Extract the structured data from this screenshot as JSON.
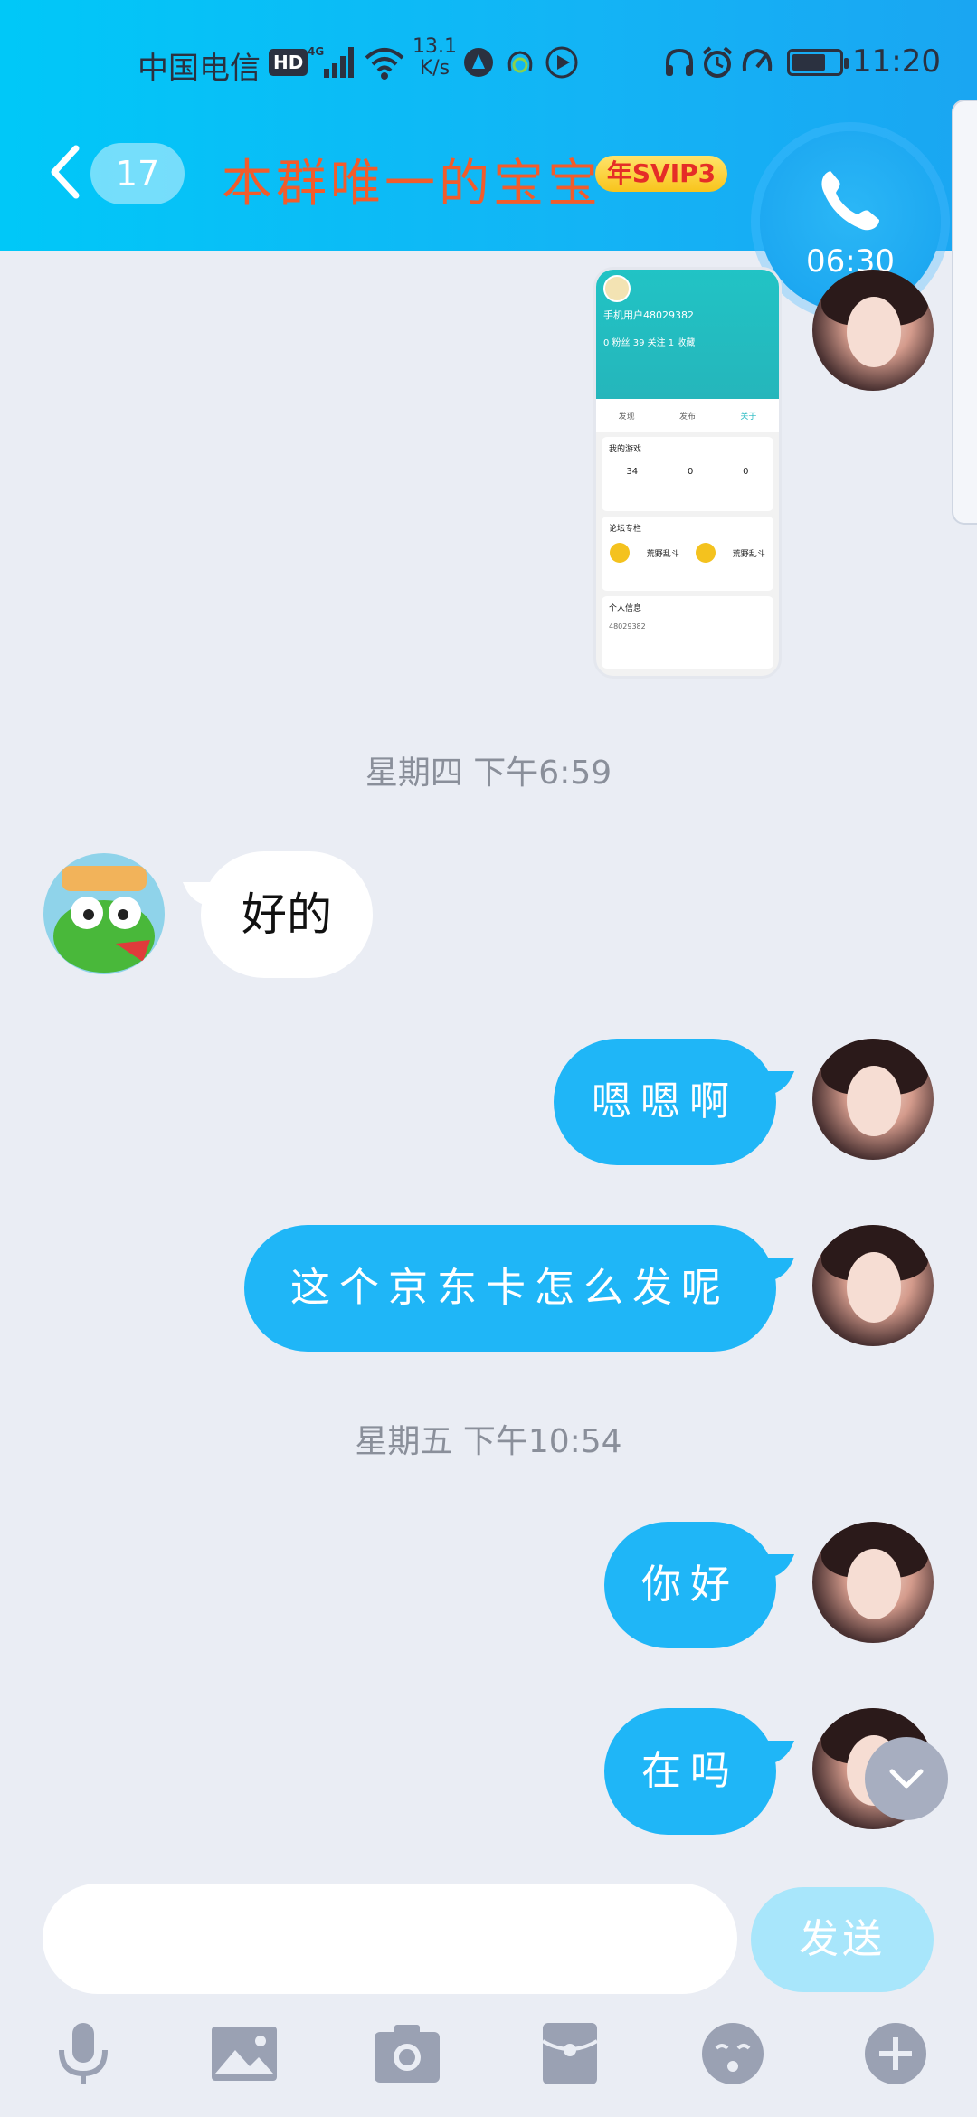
{
  "status_bar": {
    "carrier": "中国电信",
    "hd": "HD",
    "net_speed_value": "13.1",
    "net_speed_unit": "K/s",
    "time": "11:20"
  },
  "header": {
    "unread_count": "17",
    "title": "本群唯一的宝宝",
    "badge": "年SVIP3"
  },
  "call": {
    "duration": "06:30"
  },
  "shared_image": {
    "username": "手机用户48029382",
    "stats": "0 粉丝   39 关注   1 收藏",
    "tabs": [
      "发现",
      "发布",
      "关于"
    ],
    "section_games": "我的游戏",
    "game_counts": [
      "34",
      "0",
      "0"
    ],
    "section_activity": "论坛专栏",
    "game_name": "荒野乱斗",
    "section_info": "个人信息",
    "id_value": "48029382"
  },
  "messages": [
    {
      "type": "timestamp",
      "text": "星期四 下午6:59"
    },
    {
      "type": "incoming",
      "text": "好的"
    },
    {
      "type": "outgoing",
      "text": "嗯嗯啊"
    },
    {
      "type": "outgoing",
      "text": "这个京东卡怎么发呢"
    },
    {
      "type": "timestamp",
      "text": "星期五 下午10:54"
    },
    {
      "type": "outgoing",
      "text": "你好"
    },
    {
      "type": "outgoing",
      "text": "在吗"
    }
  ],
  "input": {
    "value": "",
    "send_label": "发送"
  },
  "toolbar": {
    "icons": [
      "mic-icon",
      "image-icon",
      "camera-icon",
      "red-packet-icon",
      "emoji-icon",
      "plus-icon"
    ]
  },
  "colors": {
    "header_gradient_start": "#00c8f8",
    "header_gradient_end": "#1aa6f2",
    "outgoing_bubble": "#1fb6f7",
    "title": "#f25c2b",
    "background": "#eaedf4"
  }
}
